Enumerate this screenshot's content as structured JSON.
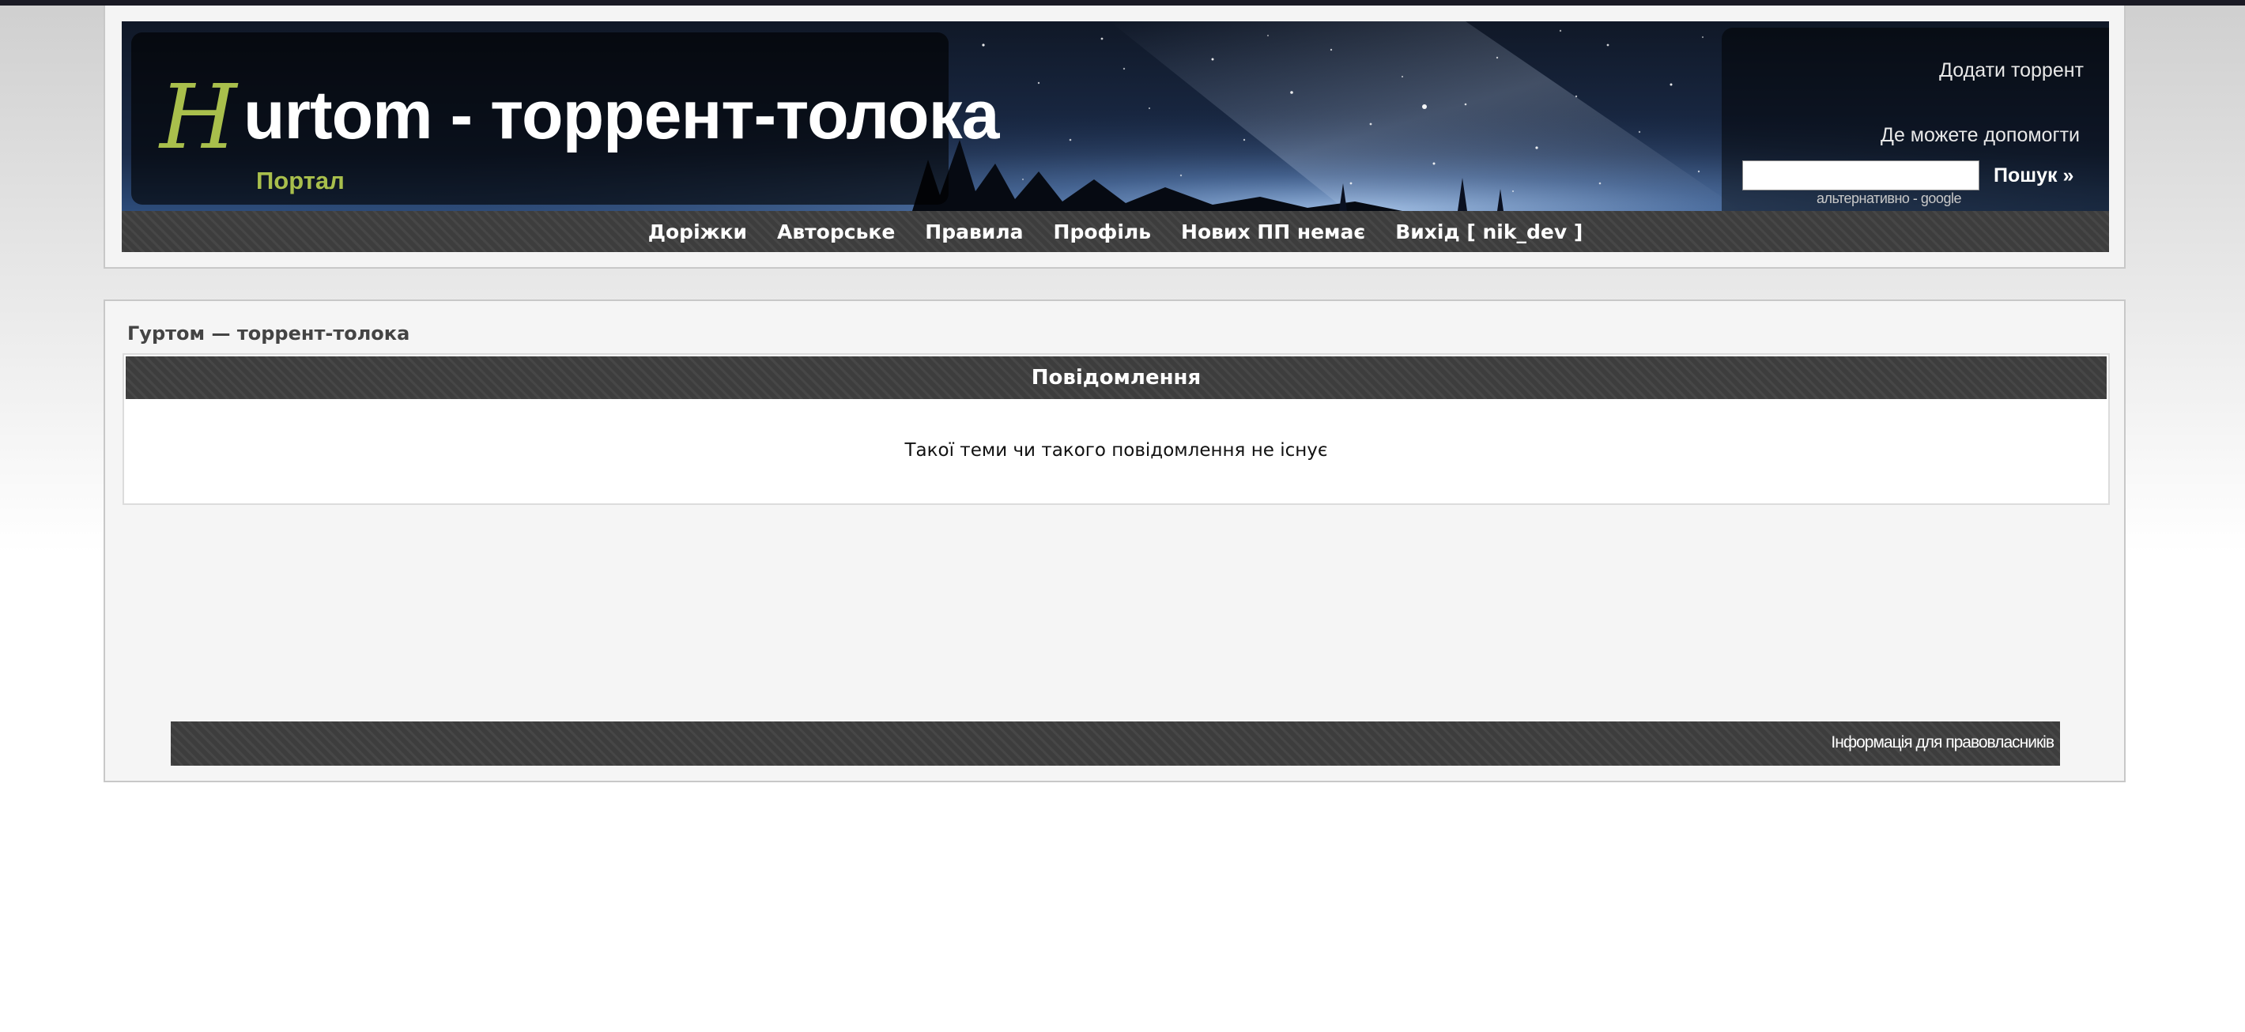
{
  "header": {
    "logo": {
      "letter": "H",
      "title": "urtom - торрент-толока",
      "subtitle": "Портал"
    },
    "links": {
      "add_torrent": "Додати торрент",
      "where_help": "Де можете допомогти"
    },
    "search": {
      "value": "",
      "button_label": "Пошук »",
      "alt_text": "альтернативно - google"
    },
    "colors": {
      "logo_accent": "#a9bf4c",
      "bar": "#3d3d3d"
    }
  },
  "nav": {
    "items": [
      {
        "label": "Доріжки"
      },
      {
        "label": "Авторське"
      },
      {
        "label": "Правила"
      },
      {
        "label": "Профіль"
      },
      {
        "label": "Нових ПП немає"
      },
      {
        "label": "Вихід [ nik_dev ]"
      }
    ]
  },
  "main": {
    "breadcrumb": "Гуртом — торрент-толока",
    "message": {
      "title": "Повідомлення",
      "text": "Такої теми чи такого повідомлення не існує"
    },
    "footer": {
      "link_label": "Інформація для правовласників"
    }
  }
}
